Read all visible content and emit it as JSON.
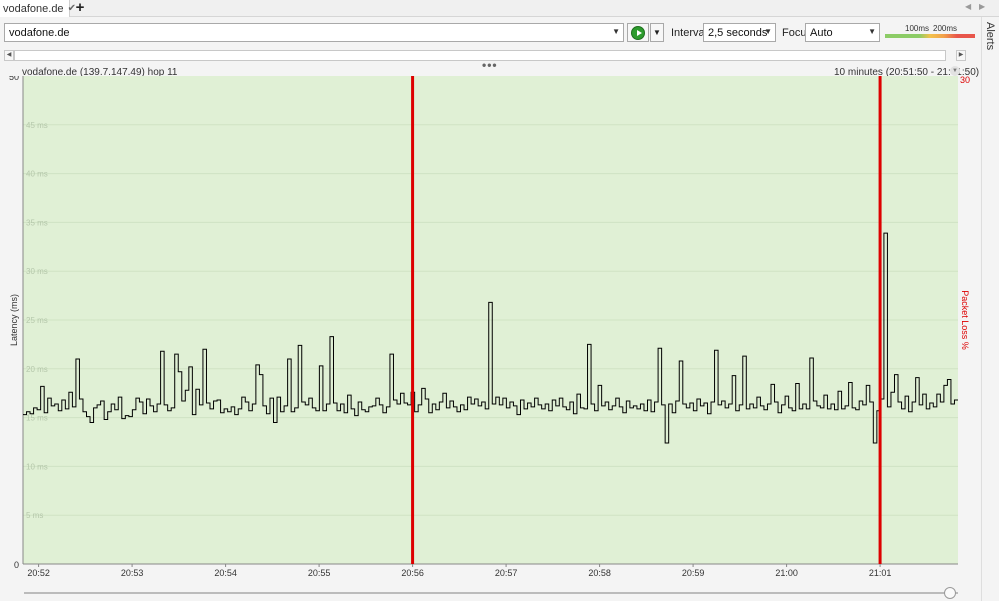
{
  "tab": {
    "label": "vodafone.de",
    "add_label": "+"
  },
  "alerts_label": "Alerts",
  "toolbar": {
    "target": "vodafone.de",
    "interval_label": "Interval",
    "interval_value": "2,5 seconds",
    "focus_label": "Focus",
    "focus_value": "Auto",
    "legend_100": "100ms",
    "legend_200": "200ms"
  },
  "chart_header": {
    "title": "vodafone.de (139.7.147.49) hop 11",
    "time_range": "10 minutes (20:51:50 - 21:01:50)"
  },
  "colors": {
    "plot_background": "#e0f0d5",
    "latency_line": "#000000",
    "packet_loss": "#dd0000",
    "grid_text": "#b5c7ab"
  },
  "chart_data": {
    "type": "line",
    "ylabel": "Latency (ms)",
    "y2label": "Packet Loss %",
    "ylim": [
      0,
      50
    ],
    "y2lim": [
      0,
      30
    ],
    "x_range": [
      "20:51:50",
      "21:01:50"
    ],
    "y_tick_labels": [
      "0",
      "5 ms",
      "10 ms",
      "15 ms",
      "20 ms",
      "25 ms",
      "30 ms",
      "35 ms",
      "40 ms",
      "45 ms",
      "50"
    ],
    "y_ticks": [
      0,
      5,
      10,
      15,
      20,
      25,
      30,
      35,
      40,
      45,
      50
    ],
    "y2_tick_labels": [
      "30"
    ],
    "x_ticks": [
      {
        "label": "20:52",
        "t": 10
      },
      {
        "label": "20:53",
        "t": 70
      },
      {
        "label": "20:54",
        "t": 130
      },
      {
        "label": "20:55",
        "t": 190
      },
      {
        "label": "20:56",
        "t": 250
      },
      {
        "label": "20:57",
        "t": 310
      },
      {
        "label": "20:58",
        "t": 370
      },
      {
        "label": "20:59",
        "t": 430
      },
      {
        "label": "21:00",
        "t": 490
      },
      {
        "label": "21:01",
        "t": 550
      }
    ],
    "packet_loss_events": [
      {
        "time": "20:56:00",
        "t": 250
      },
      {
        "time": "21:01:00",
        "t": 550
      }
    ],
    "latency_ms": [
      15.3,
      15.6,
      15.4,
      16.0,
      15.8,
      18.2,
      15.5,
      17.0,
      16.2,
      16.4,
      15.7,
      16.8,
      15.9,
      17.6,
      16.1,
      21.0,
      16.9,
      15.6,
      15.1,
      14.5,
      16.0,
      16.3,
      16.7,
      14.8,
      15.6,
      16.4,
      15.8,
      17.1,
      14.9,
      15.2,
      15.1,
      15.8,
      17.0,
      16.6,
      15.4,
      16.9,
      16.2,
      15.6,
      16.4,
      21.8,
      16.3,
      15.7,
      16.0,
      21.5,
      19.7,
      16.7,
      17.8,
      20.2,
      15.3,
      17.9,
      16.3,
      22.0,
      16.5,
      15.9,
      16.7,
      16.8,
      15.5,
      15.9,
      15.6,
      16.1,
      15.3,
      15.9,
      17.1,
      16.6,
      15.7,
      16.4,
      20.4,
      19.4,
      16.2,
      15.4,
      17.0,
      14.5,
      17.1,
      15.6,
      16.2,
      21.0,
      15.6,
      16.0,
      22.4,
      16.6,
      16.3,
      17.0,
      16.0,
      15.7,
      20.3,
      15.7,
      16.4,
      23.3,
      16.5,
      15.7,
      16.4,
      15.5,
      17.3,
      15.9,
      15.2,
      16.6,
      15.8,
      15.6,
      16.1,
      16.2,
      17.0,
      16.3,
      15.5,
      16.1,
      21.5,
      16.8,
      16.4,
      17.5,
      16.5,
      16.3,
      17.6,
      15.6,
      16.3,
      18.0,
      16.9,
      15.5,
      16.4,
      15.8,
      16.6,
      17.5,
      16.0,
      16.7,
      16.1,
      15.6,
      16.3,
      15.8,
      17.1,
      16.4,
      16.9,
      16.2,
      16.6,
      15.9,
      26.8,
      16.4,
      17.1,
      16.3,
      17.0,
      16.0,
      16.6,
      16.2,
      15.3,
      16.8,
      15.9,
      16.5,
      16.1,
      17.0,
      16.3,
      15.9,
      16.4,
      15.7,
      16.8,
      16.2,
      17.0,
      16.1,
      15.8,
      16.6,
      15.4,
      17.4,
      16.0,
      15.9,
      22.5,
      16.4,
      15.7,
      18.3,
      16.2,
      16.6,
      15.8,
      16.2,
      17.0,
      16.1,
      15.5,
      16.7,
      16.0,
      16.2,
      15.9,
      16.4,
      15.7,
      16.8,
      15.6,
      16.6,
      22.1,
      16.3,
      12.4,
      16.4,
      15.5,
      16.7,
      20.8,
      16.4,
      16.0,
      16.5,
      15.7,
      16.9,
      16.2,
      16.5,
      15.4,
      16.6,
      21.9,
      16.3,
      16.7,
      16.0,
      16.4,
      19.3,
      15.7,
      16.3,
      21.3,
      15.9,
      16.4,
      16.0,
      17.1,
      16.2,
      15.8,
      16.4,
      18.4,
      16.6,
      15.5,
      16.3,
      17.2,
      16.0,
      15.7,
      18.5,
      15.9,
      16.4,
      15.9,
      21.1,
      16.7,
      16.2,
      16.0,
      17.3,
      15.9,
      16.4,
      15.8,
      17.7,
      15.9,
      16.2,
      18.6,
      16.0,
      15.8,
      16.7,
      16.3,
      18.3,
      16.6,
      12.4,
      15.7,
      16.9,
      33.9,
      16.1,
      17.6,
      19.4,
      16.6,
      15.9,
      17.2,
      15.6,
      16.6,
      19.1,
      16.3,
      17.4,
      15.9,
      16.5,
      16.1,
      17.4,
      16.6,
      18.3,
      18.9,
      16.4,
      16.8
    ]
  }
}
